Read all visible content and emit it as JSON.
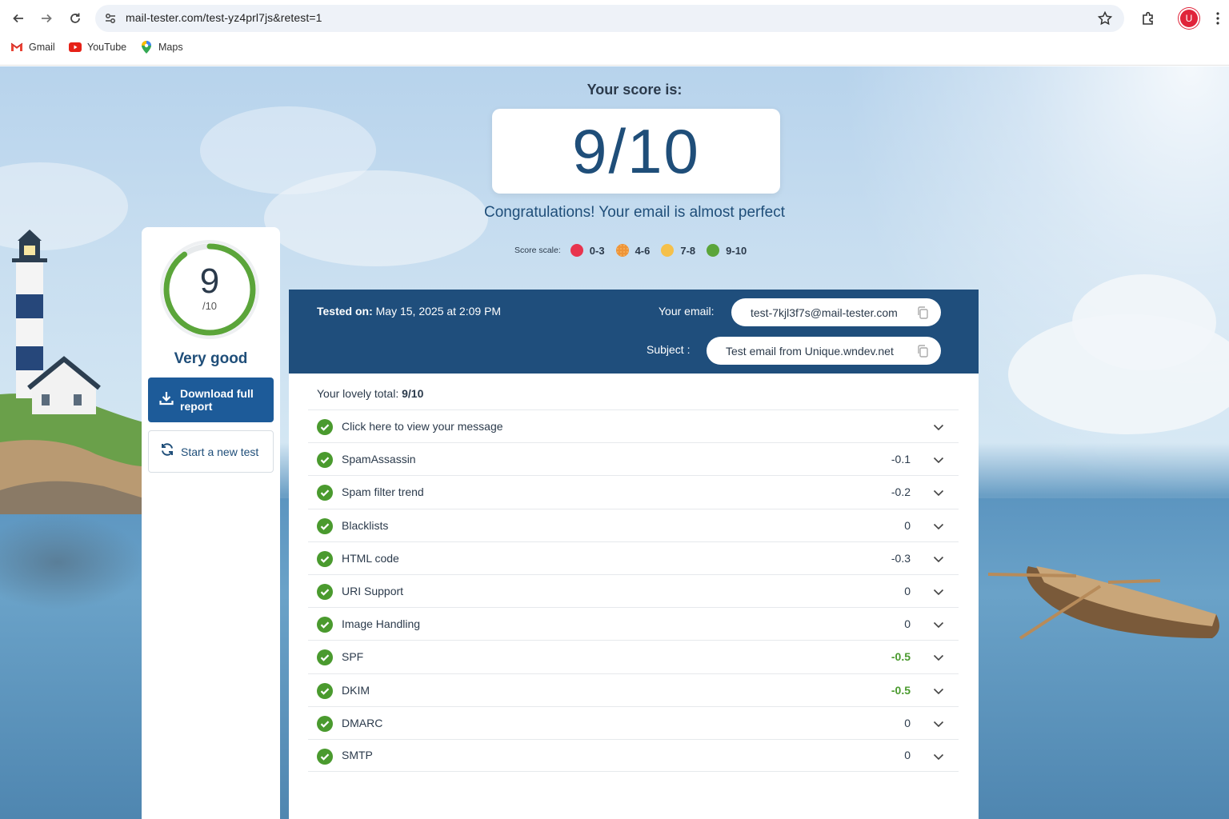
{
  "browser": {
    "url": "mail-tester.com/test-yz4prl7js&retest=1",
    "avatar_letter": "U",
    "bookmarks": [
      "Gmail",
      "YouTube",
      "Maps"
    ]
  },
  "header": {
    "score_label": "Your score is:",
    "score": "9/10",
    "congrats": "Congratulations! Your email is almost perfect",
    "scale_label": "Score scale:",
    "scale": [
      {
        "range": "0-3",
        "color": "#e8344e"
      },
      {
        "range": "4-6",
        "color": "#f4a04a"
      },
      {
        "range": "7-8",
        "color": "#f5c04a"
      },
      {
        "range": "9-10",
        "color": "#5ba53a"
      }
    ]
  },
  "left_card": {
    "gauge_value": "9",
    "gauge_max": "/10",
    "gauge_fraction": 0.9,
    "grade": "Very good",
    "download_label": "Download full report",
    "new_test_label": "Start a new test"
  },
  "info": {
    "tested_label": "Tested on:",
    "tested_value": "May 15, 2025 at 2:09 PM",
    "email_label": "Your email:",
    "email_value": "test-7kjl3f7s@mail-tester.com",
    "subject_label": "Subject :",
    "subject_value": "Test email from Unique.wndev.net"
  },
  "results": {
    "total_label": "Your lovely total:",
    "total_value": "9/10",
    "rows": [
      {
        "name": "Click here to view your message",
        "value": "",
        "green": false
      },
      {
        "name": "SpamAssassin",
        "value": "-0.1",
        "green": false
      },
      {
        "name": "Spam filter trend",
        "value": "-0.2",
        "green": false
      },
      {
        "name": "Blacklists",
        "value": "0",
        "green": false
      },
      {
        "name": "HTML code",
        "value": "-0.3",
        "green": false
      },
      {
        "name": "URI Support",
        "value": "0",
        "green": false
      },
      {
        "name": "Image Handling",
        "value": "0",
        "green": false
      },
      {
        "name": "SPF",
        "value": "-0.5",
        "green": true
      },
      {
        "name": "DKIM",
        "value": "-0.5",
        "green": true
      },
      {
        "name": "DMARC",
        "value": "0",
        "green": false
      },
      {
        "name": "SMTP",
        "value": "0",
        "green": false
      }
    ]
  },
  "colors": {
    "brand_blue": "#1f4e7c",
    "button_blue": "#1d5b99",
    "success_green": "#4a9a2e",
    "gauge_green": "#5ba53a"
  }
}
